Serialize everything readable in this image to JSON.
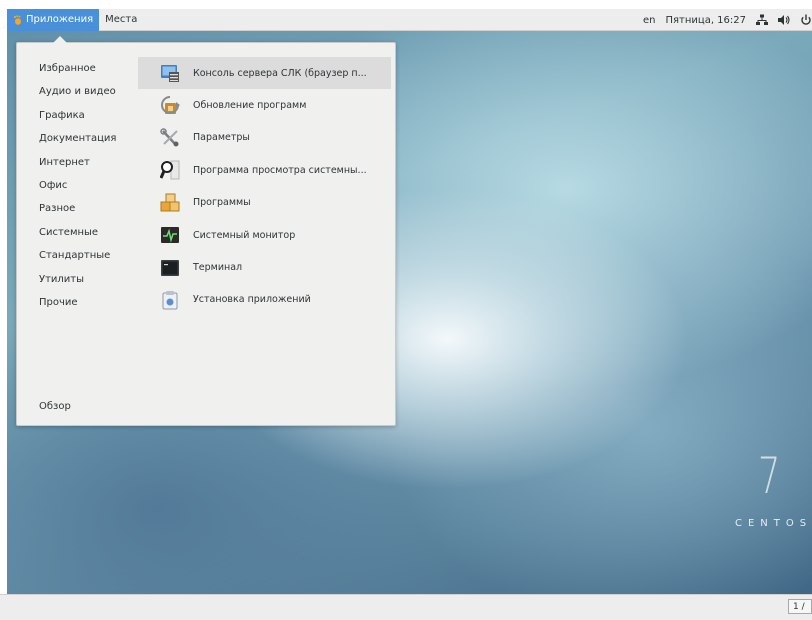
{
  "topbar": {
    "applications_label": "Приложения",
    "places_label": "Места",
    "keyboard_layout": "en",
    "clock": "Пятница, 16:27"
  },
  "menu": {
    "categories": [
      {
        "label": "Избранное"
      },
      {
        "label": "Аудио и видео"
      },
      {
        "label": "Графика"
      },
      {
        "label": "Документация"
      },
      {
        "label": "Интернет"
      },
      {
        "label": "Офис"
      },
      {
        "label": "Разное"
      },
      {
        "label": "Системные"
      },
      {
        "label": "Стандартные"
      },
      {
        "label": "Утилиты"
      },
      {
        "label": "Прочие"
      }
    ],
    "overview_label": "Обзор",
    "apps": [
      {
        "label": "Консоль сервера СЛК (браузер п...",
        "icon": "server-console-icon"
      },
      {
        "label": "Обновление программ",
        "icon": "software-update-icon"
      },
      {
        "label": "Параметры",
        "icon": "settings-tools-icon"
      },
      {
        "label": "Программа просмотра системны...",
        "icon": "log-viewer-icon"
      },
      {
        "label": "Программы",
        "icon": "software-icon"
      },
      {
        "label": "Системный монитор",
        "icon": "system-monitor-icon"
      },
      {
        "label": "Терминал",
        "icon": "terminal-icon"
      },
      {
        "label": "Установка приложений",
        "icon": "package-installer-icon"
      }
    ]
  },
  "desktop": {
    "watermark_number": "7",
    "watermark_text": "CENTOS"
  },
  "bottombar": {
    "workspace": "1 /"
  },
  "colors": {
    "accent": "#4a90d9",
    "menu_bg": "#f0f0ef",
    "selected_bg": "#dcdcdc"
  }
}
